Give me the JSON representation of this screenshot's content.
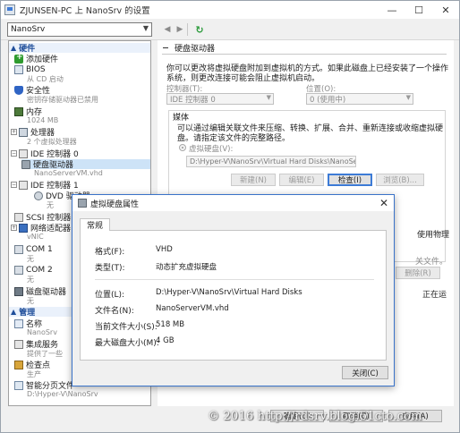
{
  "window": {
    "title": "ZJUNSEN-PC 上 NanoSrv 的设置",
    "minimize": "—",
    "maximize": "☐",
    "close": "✕"
  },
  "toolbar": {
    "vm_selected": "NanoSrv",
    "back_icon": "◀",
    "forward_icon": "▶",
    "refresh_icon": "↻"
  },
  "sidebar": {
    "hardware_header": "硬件",
    "management_header": "管理",
    "items": [
      {
        "label": "添加硬件",
        "sub": ""
      },
      {
        "label": "BIOS",
        "sub": "从 CD 启动"
      },
      {
        "label": "安全性",
        "sub": "密钥存储驱动器已禁用"
      },
      {
        "label": "内存",
        "sub": "1024 MB"
      },
      {
        "label": "处理器",
        "sub": "2 个虚拟处理器"
      },
      {
        "label": "IDE 控制器 0",
        "sub": ""
      },
      {
        "label": "硬盘驱动器",
        "sub": "NanoServerVM.vhd"
      },
      {
        "label": "IDE 控制器 1",
        "sub": ""
      },
      {
        "label": "DVD 驱动器",
        "sub": "无"
      },
      {
        "label": "SCSI 控制器",
        "sub": ""
      },
      {
        "label": "网络适配器",
        "sub": "vNIC"
      },
      {
        "label": "COM 1",
        "sub": "无"
      },
      {
        "label": "COM 2",
        "sub": "无"
      },
      {
        "label": "磁盘驱动器",
        "sub": "无"
      }
    ],
    "mgmt_items": [
      {
        "label": "名称",
        "sub": "NanoSrv"
      },
      {
        "label": "集成服务",
        "sub": "提供了一些"
      },
      {
        "label": "检查点",
        "sub": "生产"
      },
      {
        "label": "智能分页文件",
        "sub": "D:\\Hyper-V\\NanoSrv"
      }
    ]
  },
  "main": {
    "section_title": "硬盘驱动器",
    "description_line1": "你可以更改将虚拟硬盘附加到虚拟机的方式。如果此磁盘上已经安装了一个操作",
    "description_line2": "系统，则更改连接可能会阻止虚拟机启动。",
    "controller_label": "控制器(T):",
    "controller_value": "IDE 控制器 0",
    "location_label": "位置(O):",
    "location_value": "0 (使用中)",
    "media_label": "媒体",
    "media_desc_line1": "可以通过编辑关联文件来压缩、转换、扩展、合并、重新连接或收缩虚拟硬",
    "media_desc_line2": "盘。请指定该文件的完整路径。",
    "vhd_radio_label": "虚拟硬盘(V):",
    "vhd_path": "D:\\Hyper-V\\NanoSrv\\Virtual Hard Disks\\NanoServerVM.vhd",
    "btn_new": "新建(N)",
    "btn_edit": "编辑(E)",
    "btn_inspect": "检查(I)",
    "btn_browse": "浏览(B)...",
    "partial_right_1": "使用物理",
    "partial_right_2": "关文件。",
    "partial_right_3": "删除(R)",
    "partial_right_4": "正在运"
  },
  "bottom": {
    "ok": "确定(O)",
    "cancel": "取消(C)",
    "apply": "应用(A)"
  },
  "dialog": {
    "title": "虚拟硬盘属性",
    "tab": "常规",
    "format_label": "格式(F):",
    "format_value": "VHD",
    "type_label": "类型(T):",
    "type_value": "动态扩充虚拟硬盘",
    "location_label": "位置(L):",
    "location_value": "D:\\Hyper-V\\NanoSrv\\Virtual Hard Disks",
    "filename_label": "文件名(N):",
    "filename_value": "NanoServerVM.vhd",
    "cursize_label": "当前文件大小(S):",
    "cursize_value": "518 MB",
    "maxsize_label": "最大磁盘大小(M):",
    "maxsize_value": "4 GB",
    "close_button": "关闭(C)",
    "close_icon": "✕"
  },
  "watermark": "© 2016 http://rdsrv.blog.51cto.com",
  "icons": {
    "title": "hyperv-settings-icon",
    "expand": "⊟",
    "collapse": "⊞"
  }
}
